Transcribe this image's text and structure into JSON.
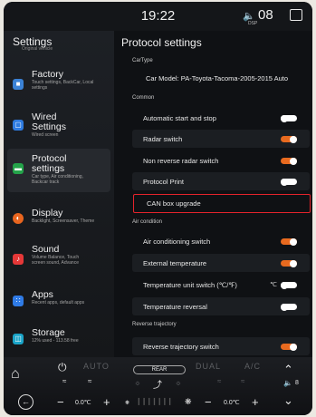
{
  "status_bar": {
    "time": "19:22",
    "volume_icon": "speaker-icon",
    "volume": "08",
    "volume_sub": "DSP",
    "window_icon": "window-icon"
  },
  "sidebar": {
    "title": "Settings",
    "subtitle": "Original vehicle",
    "items": [
      {
        "label": "Factory",
        "desc": "Touch settings, BackCar, Local settings",
        "icon": "factory-icon",
        "color": "#3b82d6"
      },
      {
        "label": "Wired Settings",
        "desc": "Wired screen",
        "icon": "wired-icon",
        "color": "#2e7be0"
      },
      {
        "label": "Protocol settings",
        "desc": "Car type, Air conditioning, Backcar track",
        "icon": "protocol-icon",
        "color": "#24a34a"
      },
      {
        "label": "Display",
        "desc": "Backlight, Screensaver, Theme",
        "icon": "display-icon",
        "color": "#e8651f"
      },
      {
        "label": "Sound",
        "desc": "Volume Balance, Touch screen sound, Advance",
        "icon": "sound-icon",
        "color": "#e53838"
      },
      {
        "label": "Apps",
        "desc": "Recent apps, default apps",
        "icon": "apps-icon",
        "color": "#2f7be6"
      },
      {
        "label": "Storage",
        "desc": "12% used - 113.58 free",
        "icon": "storage-icon",
        "color": "#1aa4c8"
      }
    ]
  },
  "main": {
    "title": "Protocol settings",
    "section_cartype": "CarType",
    "car_model": "Car Model: PA-Toyota-Tacoma-2005-2015 Auto",
    "section_common": "Common",
    "common": [
      {
        "label": "Automatic start and stop",
        "state": "off"
      },
      {
        "label": "Radar switch",
        "state": "on"
      },
      {
        "label": "Non reverse radar switch",
        "state": "on"
      },
      {
        "label": "Protocol Print",
        "state": "off"
      },
      {
        "label": "CAN box upgrade",
        "state": "none"
      }
    ],
    "section_air": "Air condition",
    "air": [
      {
        "label": "Air conditioning switch",
        "state": "on"
      },
      {
        "label": "External temperature",
        "state": "on"
      },
      {
        "label": "Temperature unit switch (℃/℉)",
        "state": "off",
        "unit": "℃"
      },
      {
        "label": "Temperature reversal",
        "state": "off"
      }
    ],
    "section_reverse": "Reverse trajectory",
    "reverse": [
      {
        "label": "Reverse trajectory switch",
        "state": "on"
      }
    ]
  },
  "bottom_bar": {
    "home_icon": "home-icon",
    "power_icon": "power-icon",
    "auto_label": "AUTO",
    "rear_label": "REAR",
    "dual_label": "DUAL",
    "ac_label": "A/C",
    "up_icon": "chevron-up-icon",
    "down_icon": "chevron-down-icon",
    "back_icon": "back-icon",
    "left_temp": "0.0℃",
    "right_temp": "0.0℃",
    "minus": "−",
    "plus": "+",
    "volume_value": "8",
    "accent": "#e86a1f"
  }
}
